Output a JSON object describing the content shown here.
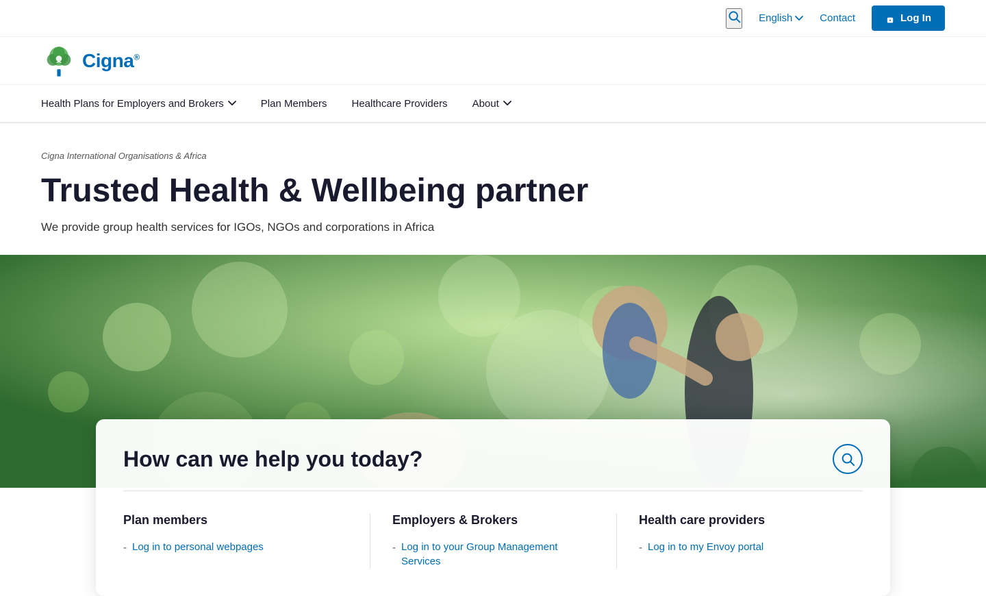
{
  "topbar": {
    "english_label": "English",
    "contact_label": "Contact",
    "login_label": "Log In"
  },
  "nav": {
    "items": [
      {
        "id": "health-plans",
        "label": "Health Plans for Employers and Brokers",
        "has_dropdown": true
      },
      {
        "id": "plan-members",
        "label": "Plan Members",
        "has_dropdown": false
      },
      {
        "id": "healthcare-providers",
        "label": "Healthcare Providers",
        "has_dropdown": false
      },
      {
        "id": "about",
        "label": "About",
        "has_dropdown": true
      }
    ]
  },
  "hero": {
    "breadcrumb": "Cigna International Organisations & Africa",
    "title": "Trusted Health & Wellbeing partner",
    "subtitle": "We provide group health services for IGOs, NGOs and corporations in Africa"
  },
  "search_card": {
    "title": "How can we help you today?",
    "sections": [
      {
        "id": "plan-members",
        "title": "Plan members",
        "links": [
          {
            "label": "Log in to personal webpages",
            "href": "#"
          }
        ]
      },
      {
        "id": "employers-brokers",
        "title": "Employers & Brokers",
        "links": [
          {
            "label": "Log in to your Group Management Services",
            "href": "#"
          }
        ]
      },
      {
        "id": "health-care-providers",
        "title": "Health care providers",
        "links": [
          {
            "label": "Log in to my Envoy portal",
            "href": "#"
          }
        ]
      }
    ]
  },
  "logo": {
    "brand_name": "Cigna",
    "registered": "®"
  }
}
